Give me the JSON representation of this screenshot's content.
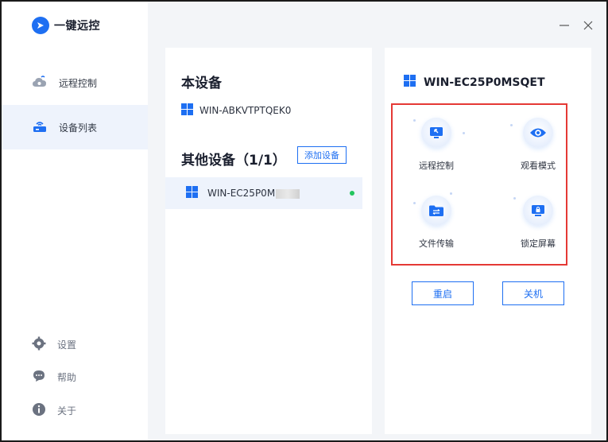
{
  "app": {
    "name": "一键远控"
  },
  "sidebar": {
    "items": [
      {
        "label": "远程控制"
      },
      {
        "label": "设备列表"
      }
    ],
    "bottom": [
      {
        "label": "设置"
      },
      {
        "label": "帮助"
      },
      {
        "label": "关于"
      }
    ]
  },
  "device_list": {
    "this_device_title": "本设备",
    "this_device_name": "WIN-ABKVTPTQEK0",
    "other_devices_title": "其他设备（1/1）",
    "add_device_label": "添加设备",
    "devices": [
      {
        "name": "WIN-EC25P0M",
        "status": "online"
      }
    ]
  },
  "target": {
    "name": "WIN-EC25P0MSQET",
    "actions": [
      {
        "label": "远程控制"
      },
      {
        "label": "观看模式"
      },
      {
        "label": "文件传输"
      },
      {
        "label": "锁定屏幕"
      }
    ],
    "restart_label": "重启",
    "shutdown_label": "关机"
  },
  "colors": {
    "accent": "#1e6ff2",
    "online": "#22c55e",
    "highlight": "#e53935"
  }
}
